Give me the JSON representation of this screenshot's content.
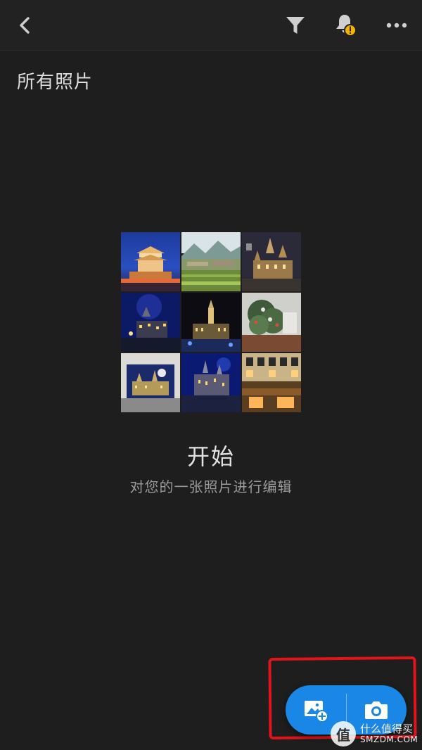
{
  "header": {
    "back_icon": "chevron-left-icon",
    "filter_icon": "filter-icon",
    "notifications_icon": "bell-alert-icon",
    "more_icon": "more-horizontal-icon",
    "notification_badge_color": "#f5b400"
  },
  "page": {
    "title": "所有照片"
  },
  "empty_state": {
    "heading": "开始",
    "subtitle": "对您的一张照片进行编辑",
    "collage_items": [
      "night-drum-tower-photo",
      "mountain-village-photo",
      "castle-night-photo",
      "blue-night-castle-photo",
      "illuminated-tower-photo",
      "christmas-tree-photo",
      "lego-castle-photo",
      "hogwarts-night-photo",
      "building-facade-photo"
    ]
  },
  "actions": {
    "add_photos_icon": "add-photo-icon",
    "camera_icon": "camera-icon",
    "accent_color": "#1a86e6",
    "annotation_color": "#e0141a"
  },
  "watermark": {
    "badge": "值",
    "line1": "什么值得买",
    "line2": "SMZDM.COM"
  }
}
